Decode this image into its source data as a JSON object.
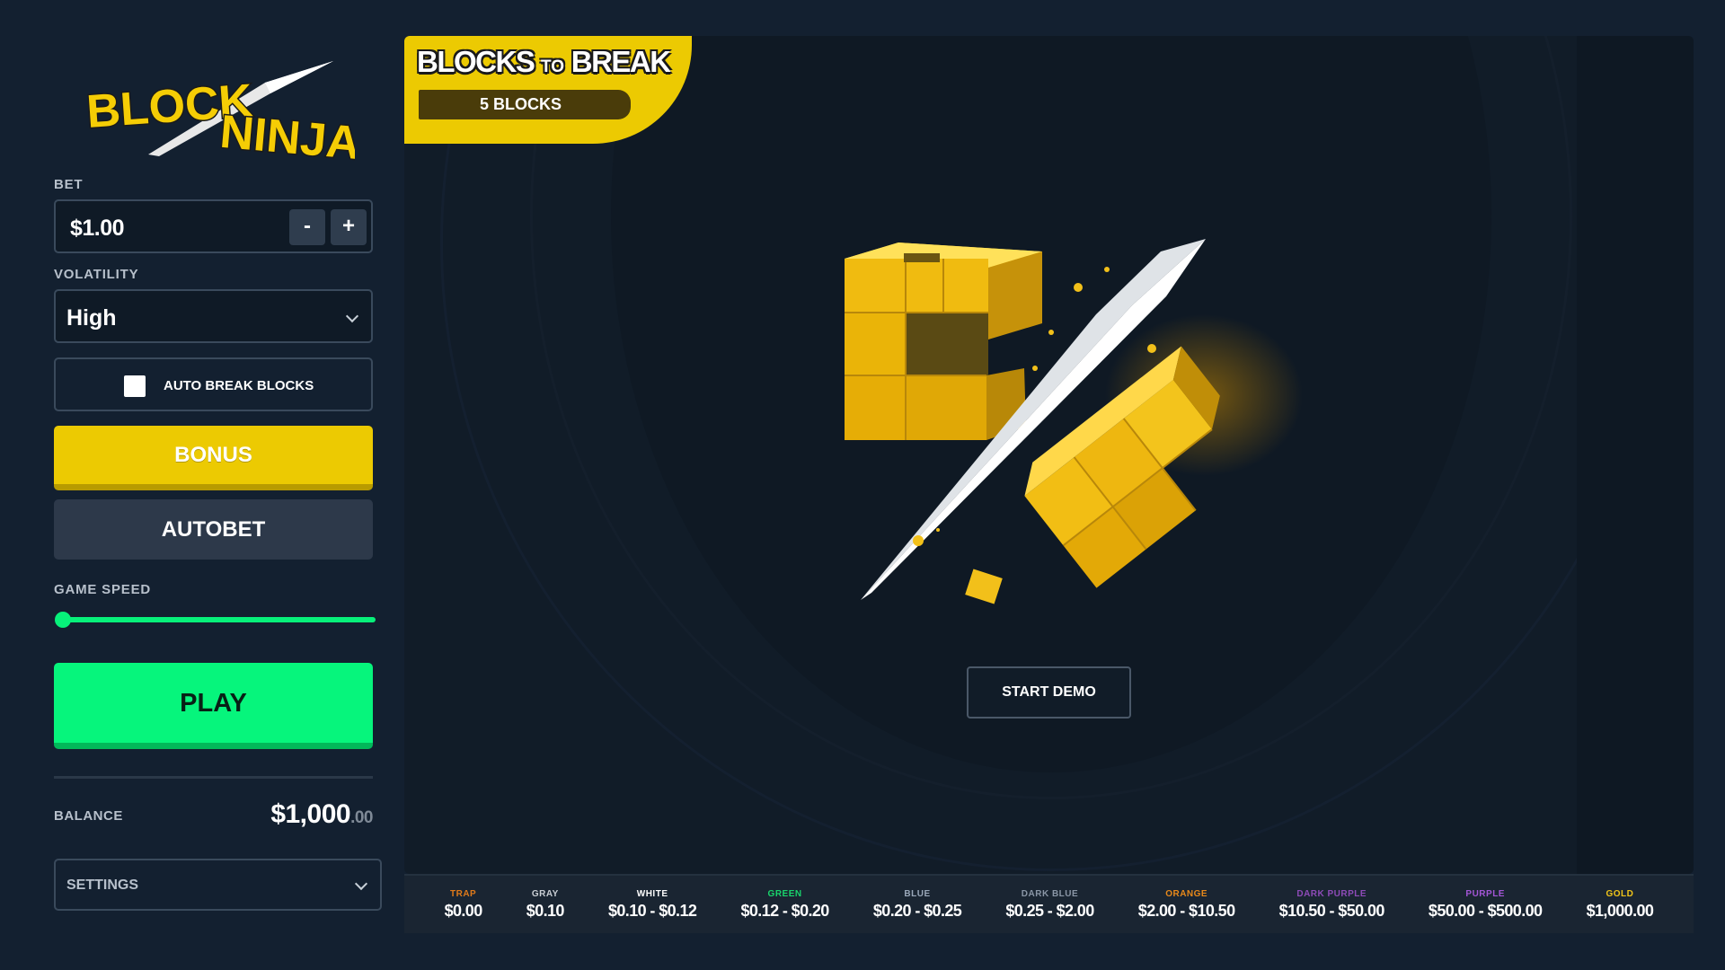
{
  "sidebar": {
    "logo_text": "BLOCK NINJA",
    "bet": {
      "label": "BET",
      "value": "$1.00",
      "decrement_label": "-",
      "increment_label": "+"
    },
    "volatility": {
      "label": "VOLATILITY",
      "value": "High"
    },
    "auto_break": {
      "label": "AUTO BREAK BLOCKS",
      "checked": false
    },
    "bonus_label": "BONUS",
    "autobet_label": "AUTOBET",
    "game_speed": {
      "label": "GAME SPEED",
      "level": 0
    },
    "play_label": "PLAY",
    "balance": {
      "label": "BALANCE",
      "dollars": "$1,000",
      "cents": ".00"
    },
    "settings_label": "SETTINGS"
  },
  "game": {
    "banner": {
      "title_left": "BLOCKS",
      "title_mid": "TO",
      "title_right": "BREAK",
      "count_text": "5 BLOCKS"
    },
    "start_demo_label": "START DEMO"
  },
  "payouts": [
    {
      "name": "TRAP",
      "range": "$0.00",
      "color": "#e07a1a"
    },
    {
      "name": "GRAY",
      "range": "$0.10",
      "color": "#c9ced4"
    },
    {
      "name": "WHITE",
      "range": "$0.10 - $0.12",
      "color": "#ffffff"
    },
    {
      "name": "GREEN",
      "range": "$0.12 - $0.20",
      "color": "#19d46c"
    },
    {
      "name": "BLUE",
      "range": "$0.20 - $0.25",
      "color": "#9aa8ba"
    },
    {
      "name": "DARK BLUE",
      "range": "$0.25 - $2.00",
      "color": "#8a96a6"
    },
    {
      "name": "ORANGE",
      "range": "$2.00 - $10.50",
      "color": "#e8891a"
    },
    {
      "name": "DARK PURPLE",
      "range": "$10.50 - $50.00",
      "color": "#8e4bb8"
    },
    {
      "name": "PURPLE",
      "range": "$50.00 - $500.00",
      "color": "#a356d6"
    },
    {
      "name": "GOLD",
      "range": "$1,000.00",
      "color": "#f0c419"
    }
  ]
}
